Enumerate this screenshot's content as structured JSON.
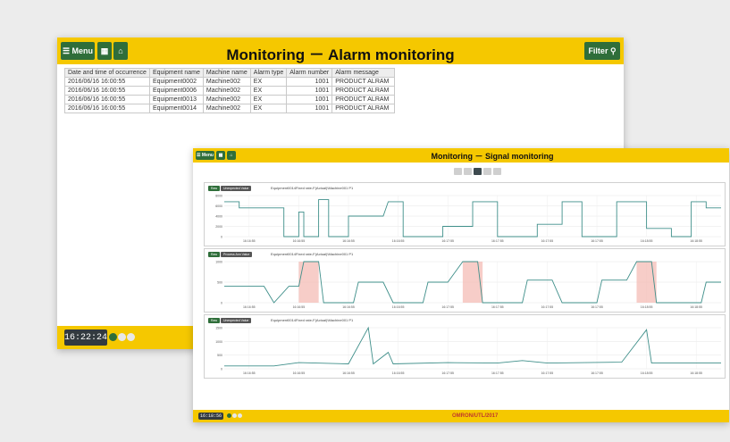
{
  "alarm_window": {
    "title": "Monitoring － Alarm monitoring",
    "menu_label": "Menu",
    "filter_label": "Filter",
    "columns": [
      "Date and time of occurrence",
      "Equipment name",
      "Machine name",
      "Alarm type",
      "Alarm number",
      "Alarm message"
    ],
    "rows": [
      [
        "2016/06/16 16:00:55",
        "Equipment0002",
        "Machine002",
        "EX",
        "1001",
        "PRODUCT ALRAM"
      ],
      [
        "2016/06/16 16:00:55",
        "Equipment0006",
        "Machine002",
        "EX",
        "1001",
        "PRODUCT ALRAM"
      ],
      [
        "2016/06/16 16:00:55",
        "Equipment0013",
        "Machine002",
        "EX",
        "1001",
        "PRODUCT ALRAM"
      ],
      [
        "2016/06/16 16:00:55",
        "Equipment0014",
        "Machine002",
        "EX",
        "1001",
        "PRODUCT ALRAM"
      ]
    ],
    "clock": "16:22:24"
  },
  "signal_window": {
    "title": "Monitoring － Signal monitoring",
    "menu_label": "Menu",
    "clock": "16:18:56",
    "logo": "OMRON/UTL/2017",
    "panels": [
      {
        "tab_a": "Raw",
        "tab_b": "Unexpected Value",
        "caption": "Equipment0014Fixed rate-F(Actual)\\Machine001 P1",
        "y_ticks": [
          "8000",
          "6000",
          "4000",
          "2000",
          "0"
        ],
        "x_ticks": [
          "16:16:55",
          "16:16:55",
          "16:16:55",
          "16:16:55",
          "16:17:55",
          "16:17:55",
          "16:17:55",
          "16:17:55",
          "16:18:55",
          "16:18:55"
        ]
      },
      {
        "tab_a": "Raw",
        "tab_b": "Process Ann Value",
        "caption": "Equipment0014Fixed rate-F(Actual)\\Machine001 P1",
        "y_ticks": [
          "1000",
          "500",
          "0"
        ],
        "x_ticks": [
          "16:16:55",
          "16:16:55",
          "16:16:55",
          "16:16:55",
          "16:17:55",
          "16:17:55",
          "16:17:55",
          "16:17:55",
          "16:18:55",
          "16:18:55"
        ]
      },
      {
        "tab_a": "Raw",
        "tab_b": "Unexpected Value",
        "caption": "Equipment0014Fixed rate-F(Actual)\\Machine001 P1",
        "y_ticks": [
          "1500",
          "1000",
          "500",
          "0"
        ],
        "x_ticks": [
          "16:16:55",
          "16:16:55",
          "16:16:55",
          "16:16:55",
          "16:17:55",
          "16:17:55",
          "16:17:55",
          "16:17:55",
          "16:18:55",
          "16:18:55"
        ]
      }
    ]
  },
  "colors": {
    "header": "#f5c800",
    "button": "#2f6e3a",
    "signal_line": "#3f8f8a",
    "alarm_band": "#f4b8b0"
  }
}
